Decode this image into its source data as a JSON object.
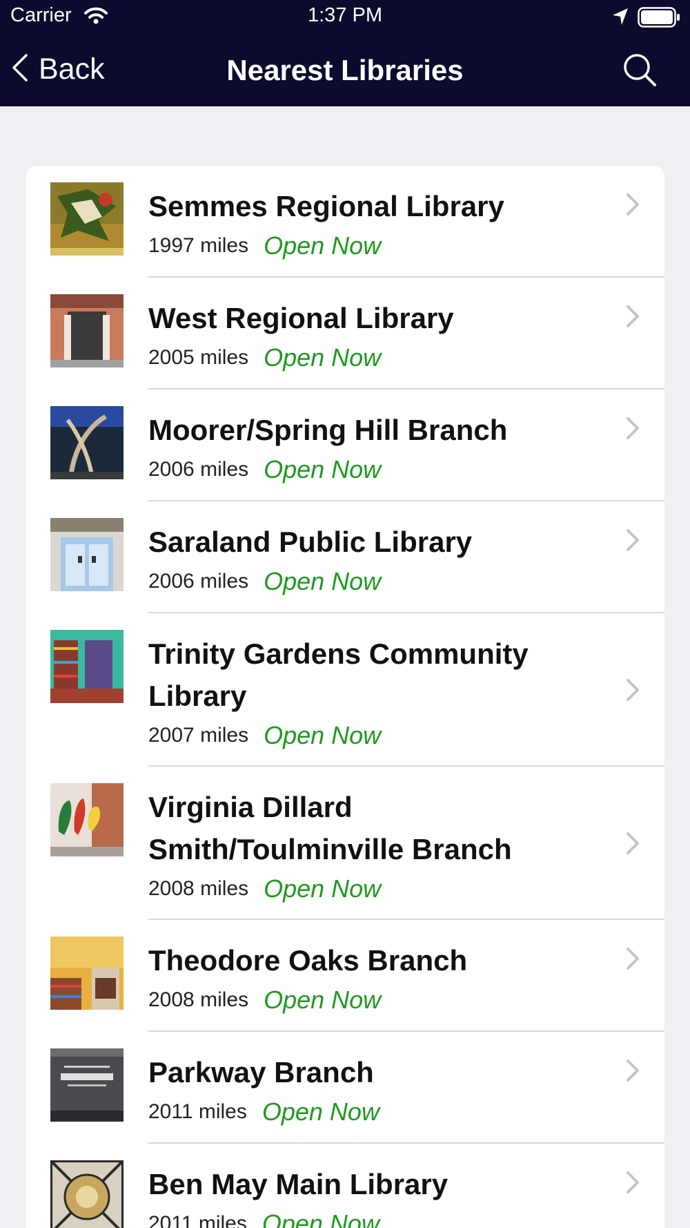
{
  "status_bar": {
    "carrier": "Carrier",
    "time": "1:37 PM"
  },
  "nav": {
    "back_label": "Back",
    "title": "Nearest Libraries"
  },
  "colors": {
    "nav_background": "#0b0b2e",
    "open_status": "#1e9a1e",
    "page_background": "#efeff4"
  },
  "libraries": [
    {
      "name": "Semmes Regional Library",
      "distance": "1997 miles",
      "status": "Open Now"
    },
    {
      "name": "West Regional Library",
      "distance": "2005 miles",
      "status": "Open Now"
    },
    {
      "name": "Moorer/Spring Hill Branch",
      "distance": "2006 miles",
      "status": "Open Now"
    },
    {
      "name": "Saraland Public Library",
      "distance": "2006 miles",
      "status": "Open Now"
    },
    {
      "name": "Trinity Gardens Community Library",
      "distance": "2007 miles",
      "status": "Open Now"
    },
    {
      "name": "Virginia Dillard Smith/Toulminville Branch",
      "distance": "2008 miles",
      "status": "Open Now"
    },
    {
      "name": "Theodore Oaks Branch",
      "distance": "2008 miles",
      "status": "Open Now"
    },
    {
      "name": "Parkway Branch",
      "distance": "2011 miles",
      "status": "Open Now"
    },
    {
      "name": "Ben May Main Library",
      "distance": "2011 miles",
      "status": "Open Now"
    }
  ]
}
